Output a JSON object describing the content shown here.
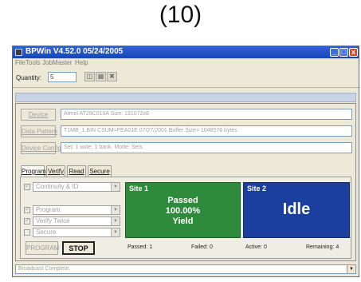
{
  "figure_label": "(10)",
  "window": {
    "title": "BPWin  V4.52.0  05/24/2005",
    "controls": {
      "minimize": "_",
      "maximize": "□",
      "close": "x"
    }
  },
  "menu": [
    "File",
    "Tools",
    "JobMaster",
    "Help"
  ],
  "toolbar": {
    "quantity_label": "Quantity:",
    "quantity_value": "5",
    "icons": [
      "open-icon",
      "save-icon",
      "settings-icon"
    ]
  },
  "setup": {
    "device_button": "Device",
    "device_info": "Atmel AT29C010A   Size: 131072x8",
    "data_pattern_button": "Data Pattern",
    "data_pattern_info": "T1MB_1.BIN   CSUM=FEA01E   07/27/2001   Buffer Size= 1048576 bytes",
    "device_config_button": "Device Config",
    "device_config_info": "Set: 1 wide, 1 bank.  Mode: Sets"
  },
  "tabs": [
    "Program",
    "Verify",
    "Read",
    "Secure"
  ],
  "active_tab": "Program",
  "operations": [
    {
      "label": "Continuity & ID",
      "checked": true
    },
    {
      "label": "Program",
      "checked": true
    },
    {
      "label": "Verify Twice",
      "checked": true
    },
    {
      "label": "Secure",
      "checked": false
    }
  ],
  "buttons": {
    "program": "PROGRAM",
    "stop": "STOP"
  },
  "sites": [
    {
      "label": "Site 1",
      "status": "Passed\n100.00%\nYield",
      "color": "#2e8b3b"
    },
    {
      "label": "Site 2",
      "status": "Idle",
      "color": "#1b3f9e"
    }
  ],
  "stats": {
    "passed": "Passed: 1",
    "failed": "Failed: 0",
    "active": "Active: 0",
    "remaining": "Remaining: 4"
  },
  "status_bar": "Broadcast Complete."
}
